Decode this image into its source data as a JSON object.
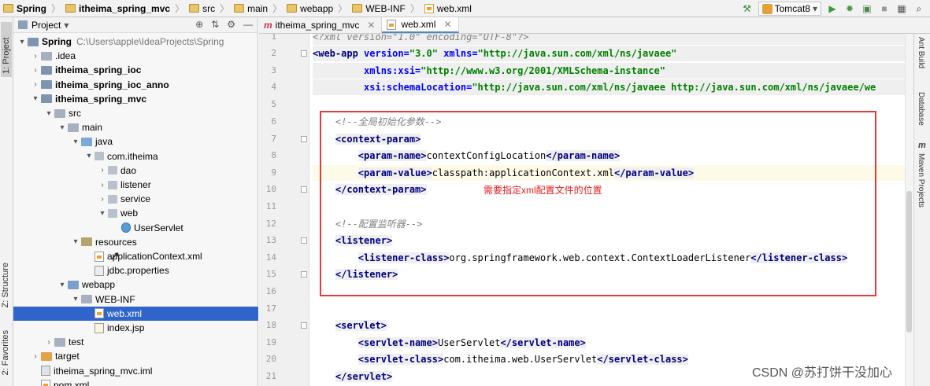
{
  "breadcrumb": {
    "items": [
      "Spring",
      "itheima_spring_mvc",
      "src",
      "main",
      "webapp",
      "WEB-INF",
      "web.xml"
    ]
  },
  "toolbar": {
    "run_config": "Tomcat8",
    "build_icon": "hammer-icon",
    "run_icon": "play-icon",
    "debug_icon": "bug-icon",
    "coverage_icon": "coverage-icon",
    "stop_icon": "stop-icon",
    "structure_icon": "project-structure-icon",
    "search_icon": "search-icon"
  },
  "left_strip": {
    "project": "1: Project",
    "structure": "Z: Structure",
    "favorites": "2: Favorites"
  },
  "right_strip": {
    "ant": "Ant Build",
    "database": "Database",
    "maven": "Maven Projects",
    "maven_mark": "m"
  },
  "project_panel": {
    "title": "Project",
    "dropdown": "▾",
    "tools": [
      "⊕",
      "⇅",
      "⚙",
      "—"
    ],
    "tree": [
      {
        "arrow": "▾",
        "label": "Spring",
        "hint": "C:\\Users\\apple\\IdeaProjects\\Spring",
        "bold": true,
        "icon": "module"
      },
      {
        "arrow": "›",
        "label": ".idea",
        "icon": "folder"
      },
      {
        "arrow": "›",
        "label": "itheima_spring_ioc",
        "bold": true,
        "icon": "module"
      },
      {
        "arrow": "›",
        "label": "itheima_spring_ioc_anno",
        "bold": true,
        "icon": "module"
      },
      {
        "arrow": "▾",
        "label": "itheima_spring_mvc",
        "bold": true,
        "icon": "module"
      },
      {
        "arrow": "▾",
        "label": "src",
        "icon": "folder"
      },
      {
        "arrow": "▾",
        "label": "main",
        "icon": "folder"
      },
      {
        "arrow": "▾",
        "label": "java",
        "icon": "src-folder"
      },
      {
        "arrow": "▾",
        "label": "com.itheima",
        "icon": "package"
      },
      {
        "arrow": "›",
        "label": "dao",
        "icon": "package"
      },
      {
        "arrow": "›",
        "label": "listener",
        "icon": "package"
      },
      {
        "arrow": "›",
        "label": "service",
        "icon": "package"
      },
      {
        "arrow": "▾",
        "label": "web",
        "icon": "package"
      },
      {
        "arrow": "",
        "label": "UserServlet",
        "icon": "java-class"
      },
      {
        "arrow": "▾",
        "label": "resources",
        "icon": "res-folder"
      },
      {
        "arrow": "",
        "label": "applicationContext.xml",
        "icon": "xml-file"
      },
      {
        "arrow": "",
        "label": "jdbc.properties",
        "icon": "properties-file"
      },
      {
        "arrow": "▾",
        "label": "webapp",
        "icon": "web-folder"
      },
      {
        "arrow": "▾",
        "label": "WEB-INF",
        "icon": "folder"
      },
      {
        "arrow": "",
        "label": "web.xml",
        "icon": "xml-file",
        "selected": true
      },
      {
        "arrow": "",
        "label": "index.jsp",
        "icon": "jsp-file"
      },
      {
        "arrow": "›",
        "label": "test",
        "icon": "folder"
      },
      {
        "arrow": "›",
        "label": "target",
        "icon": "target-folder"
      },
      {
        "arrow": "",
        "label": "itheima_spring_mvc.iml",
        "icon": "iml-file"
      },
      {
        "arrow": "",
        "label": "pom.xml",
        "icon": "maven-file"
      }
    ]
  },
  "editor": {
    "tabs": [
      {
        "label": "itheima_spring_mvc",
        "prefix": "m",
        "active": false
      },
      {
        "label": "web.xml",
        "prefix": "",
        "active": true
      }
    ],
    "line_numbers": [
      "1",
      "2",
      "3",
      "4",
      "5",
      "6",
      "7",
      "8",
      "9",
      "10",
      "11",
      "12",
      "13",
      "14",
      "15",
      "16",
      "17",
      "18",
      "19",
      "20",
      "21"
    ],
    "annotation": "需要指定xml配置文件的位置",
    "code": {
      "l1": "<?xml version=\"1.0\" encoding=\"UTF-8\"?>",
      "l2_open": "<",
      "l2_tag": "web-app",
      "l2_a1": " version=",
      "l2_v1": "\"3.0\"",
      "l2_a2": " xmlns=",
      "l2_v2": "\"http://java.sun.com/xml/ns/javaee\"",
      "l3_a": "xmlns:xsi=",
      "l3_v": "\"http://www.w3.org/2001/XMLSchema-instance\"",
      "l4_a": "xsi:schemaLocation=",
      "l4_v": "\"http://java.sun.com/xml/ns/javaee http://java.sun.com/xml/ns/javaee/we",
      "l6": "<!--全局初始化参数-->",
      "l7": "context-param",
      "l8_tag": "param-name",
      "l8_txt": "contextConfigLocation",
      "l9_tag": "param-value",
      "l9_txt": "classpath:applicationContext.xml",
      "l10": "context-param",
      "l12": "<!--配置监听器-->",
      "l13": "listener",
      "l14_tag": "listener-class",
      "l14_txt": "org.springframework.web.context.ContextLoaderListener",
      "l15": "listener",
      "l18": "servlet",
      "l19_tag": "servlet-name",
      "l19_txt": "UserServlet",
      "l20_tag": "servlet-class",
      "l20_txt": "com.itheima.web.UserServlet",
      "l21": "servlet"
    }
  },
  "watermark": "CSDN @苏打饼干没加心"
}
